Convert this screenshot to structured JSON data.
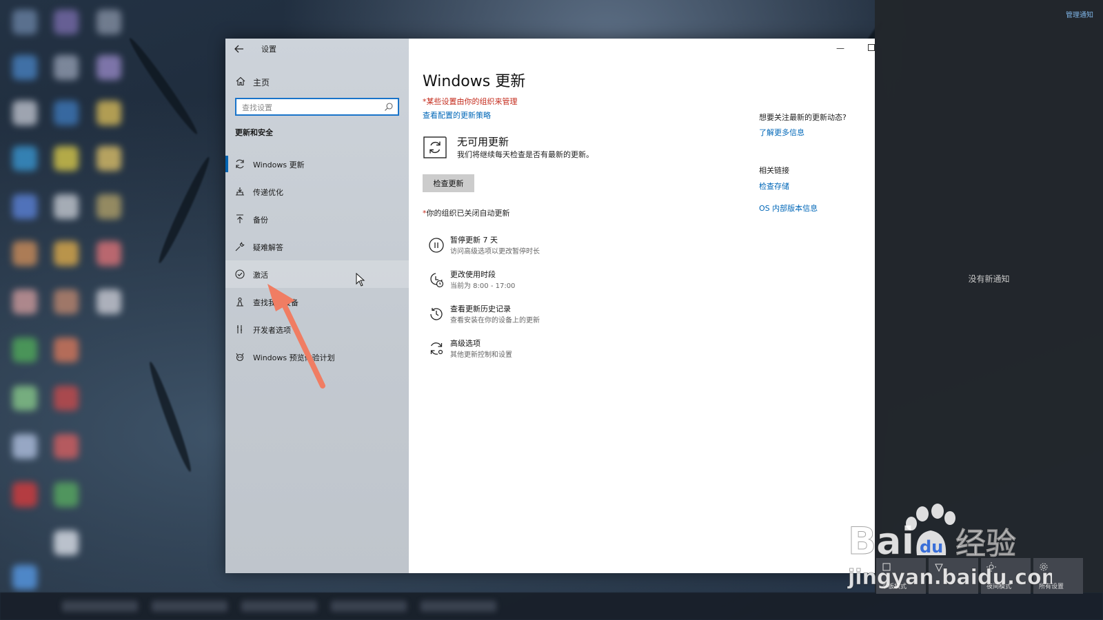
{
  "window": {
    "app_title": "设置",
    "home_label": "主页",
    "search_placeholder": "查找设置",
    "section_title": "更新和安全"
  },
  "sidebar": {
    "items": [
      {
        "label": "Windows 更新",
        "icon": "sync-icon"
      },
      {
        "label": "传递优化",
        "icon": "delivery-icon"
      },
      {
        "label": "备份",
        "icon": "upload-icon"
      },
      {
        "label": "疑难解答",
        "icon": "wrench-icon"
      },
      {
        "label": "激活",
        "icon": "check-circle-icon"
      },
      {
        "label": "查找我的设备",
        "icon": "person-pin-icon"
      },
      {
        "label": "开发者选项",
        "icon": "tools-icon"
      },
      {
        "label": "Windows 预览体验计划",
        "icon": "insider-icon"
      }
    ]
  },
  "main": {
    "title": "Windows 更新",
    "managed_note": "*某些设置由你的组织来管理",
    "policy_link": "查看配置的更新策略",
    "status_title": "无可用更新",
    "status_desc": "我们将继续每天检查是否有最新的更新。",
    "check_button": "检查更新",
    "org_note_star": "*",
    "org_note": "你的组织已关闭自动更新",
    "options": [
      {
        "title": "暂停更新 7 天",
        "desc": "访问高级选项以更改暂停时长",
        "icon": "pause-icon"
      },
      {
        "title": "更改使用时段",
        "desc": "当前为 8:00 - 17:00",
        "icon": "clock-icon"
      },
      {
        "title": "查看更新历史记录",
        "desc": "查看安装在你的设备上的更新",
        "icon": "history-icon"
      },
      {
        "title": "高级选项",
        "desc": "其他更新控制和设置",
        "icon": "advanced-sync-icon"
      }
    ]
  },
  "right_col": {
    "question": "想要关注最新的更新动态?",
    "learn_more": "了解更多信息",
    "related_title": "相关链接",
    "check_storage": "检查存储",
    "os_info": "OS 内部版本信息"
  },
  "action_center": {
    "manage": "管理通知",
    "no_notifications": "没有新通知",
    "tiles": [
      {
        "label": "平板模式",
        "icon": "tablet-icon"
      },
      {
        "label": "",
        "icon": "location-icon"
      },
      {
        "label": "夜间模式",
        "icon": "brightness-icon"
      },
      {
        "label": "所有设置",
        "icon": "gear-icon"
      }
    ]
  },
  "watermark": {
    "brand_latin": "Bai",
    "brand_du": "du",
    "brand_cn": "经验",
    "url": "jingyan.baidu.com"
  },
  "colors": {
    "accent": "#0067b8",
    "warning": "#c42b1c",
    "annotation_arrow": "#f07d63"
  }
}
